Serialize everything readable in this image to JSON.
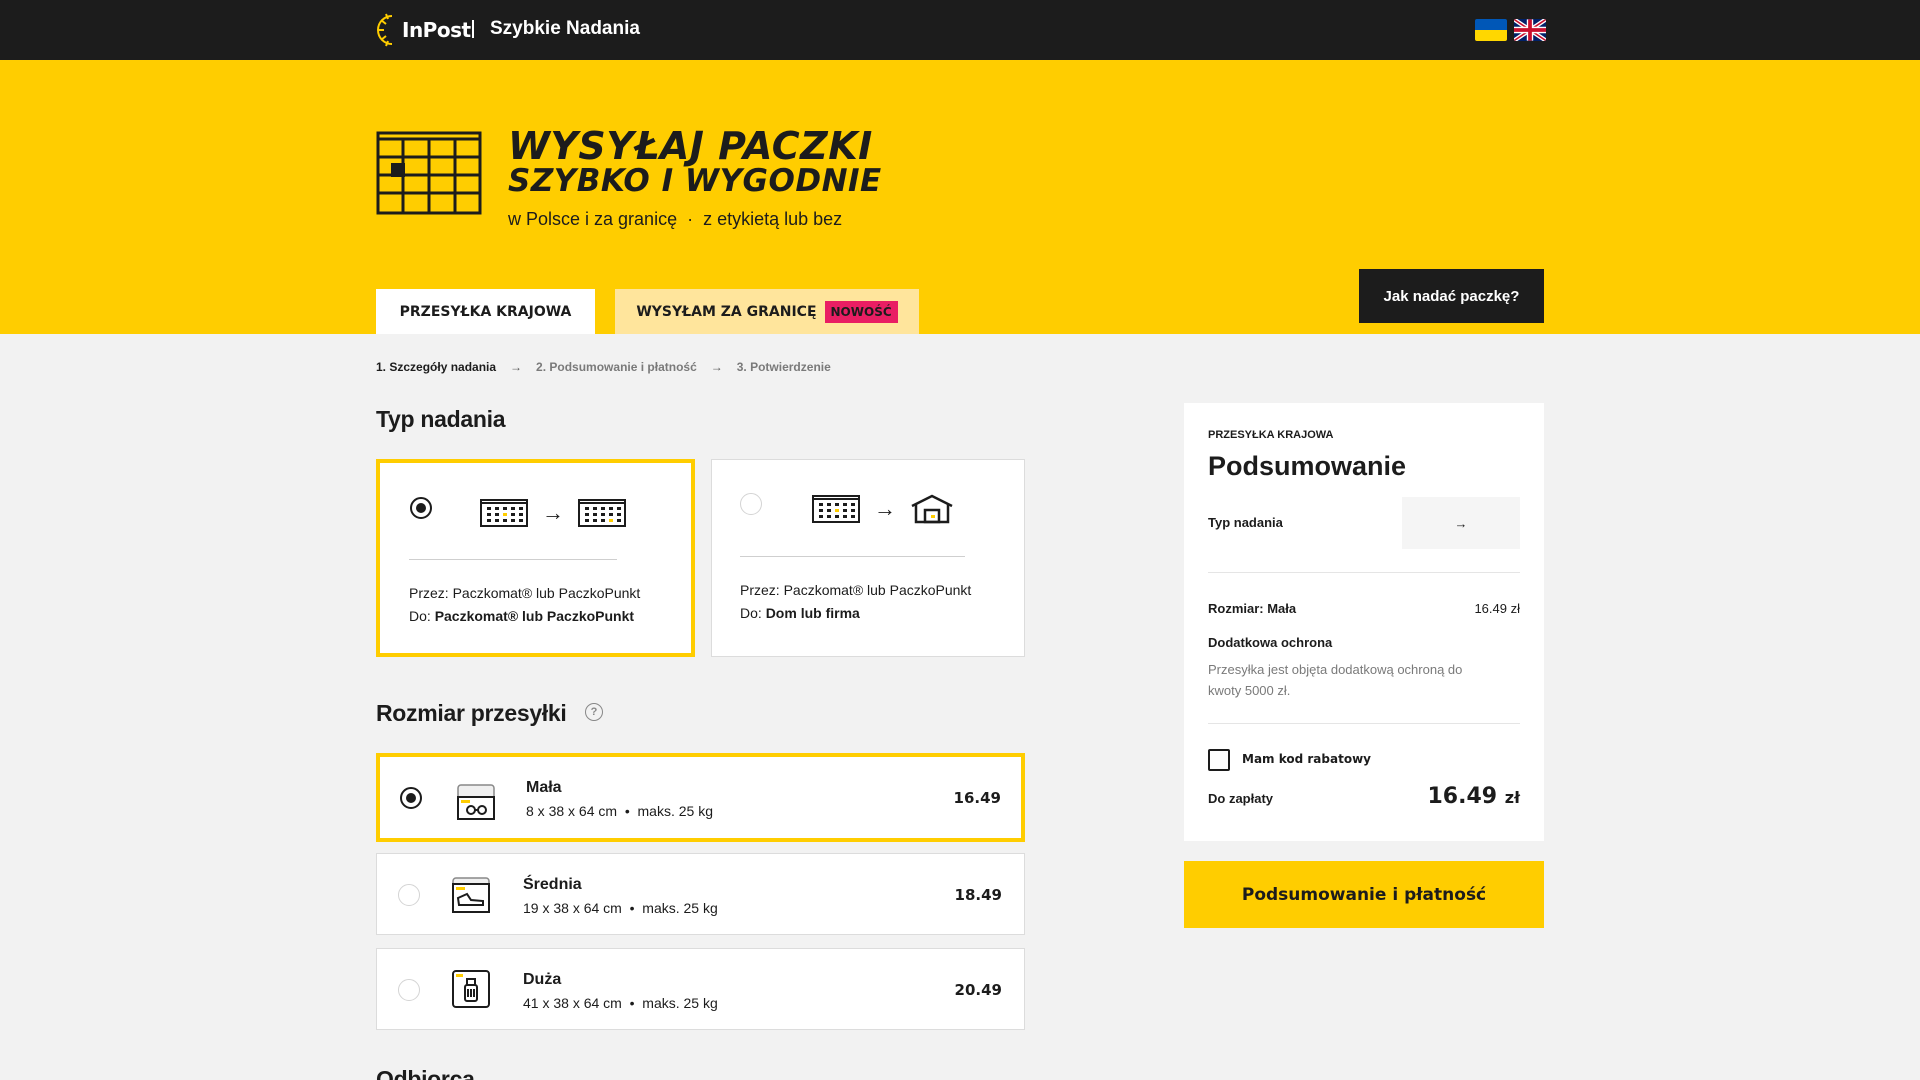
{
  "header": {
    "logo_text": "InPost",
    "app_name": "Szybkie Nadania",
    "languages": [
      "ua",
      "en"
    ]
  },
  "hero": {
    "title_line1": "WYSYŁAJ PACZKI",
    "title_line2": "SZYBKO I WYGODNIE",
    "subtitle_part1": "w Polsce i za granicę",
    "subtitle_sep": "·",
    "subtitle_part2": "z etykietą lub bez"
  },
  "tabs": [
    {
      "label": "PRZESYŁKA KRAJOWA",
      "active": true
    },
    {
      "label": "WYSYŁAM ZA GRANICĘ",
      "badge": "NOWOŚĆ",
      "active": false
    }
  ],
  "how_button": "Jak nadać paczkę?",
  "steps": {
    "s1": "1. Szczegóły nadania",
    "s2": "2. Podsumowanie i płatność",
    "s3": "3. Potwierdzenie",
    "arrow": "→"
  },
  "sections": {
    "type_title": "Typ nadania",
    "size_title": "Rozmiar przesyłki",
    "size_help": "?",
    "other_title": "Odbiorca"
  },
  "delivery_types": [
    {
      "from_label": "Przez:",
      "from_value": "Paczkomat® lub PaczkoPunkt",
      "to_label": "Do:",
      "to_value": "Paczkomat® lub PaczkoPunkt",
      "selected": true
    },
    {
      "from_label": "Przez:",
      "from_value": "Paczkomat® lub PaczkoPunkt",
      "to_label": "Do:",
      "to_value": "Dom lub firma",
      "selected": false
    }
  ],
  "arrow_glyph": "→",
  "sizes": [
    {
      "name": "Mała",
      "dims": "8 x 38 x 64 cm",
      "sep": "•",
      "weight": "maks. 25 kg",
      "price": "16.49",
      "selected": true
    },
    {
      "name": "Średnia",
      "dims": "19 x 38 x 64 cm",
      "sep": "•",
      "weight": "maks. 25 kg",
      "price": "18.49",
      "selected": false
    },
    {
      "name": "Duża",
      "dims": "41 x 38 x 64 cm",
      "sep": "•",
      "weight": "maks. 25 kg",
      "price": "20.49",
      "selected": false
    }
  ],
  "summary": {
    "kicker": "PRZESYŁKA KRAJOWA",
    "title": "Podsumowanie",
    "type_label": "Typ nadania",
    "type_value": "→",
    "size_line": "Rozmiar: Mała",
    "size_price": "16.49 zł",
    "protection_title": "Dodatkowa ochrona",
    "protection_desc": "Przesyłka jest objęta dodatkową ochroną do kwoty 5000 zł.",
    "discount_label": "Mam kod rabatowy",
    "pay_label": "Do zapłaty",
    "pay_amount": "16.49",
    "pay_currency": "zł"
  },
  "pay_button": "Podsumowanie i płatność",
  "colors": {
    "brand_yellow": "#ffcd00",
    "dark": "#1c1c1c",
    "badge_pink": "#e91e63"
  }
}
